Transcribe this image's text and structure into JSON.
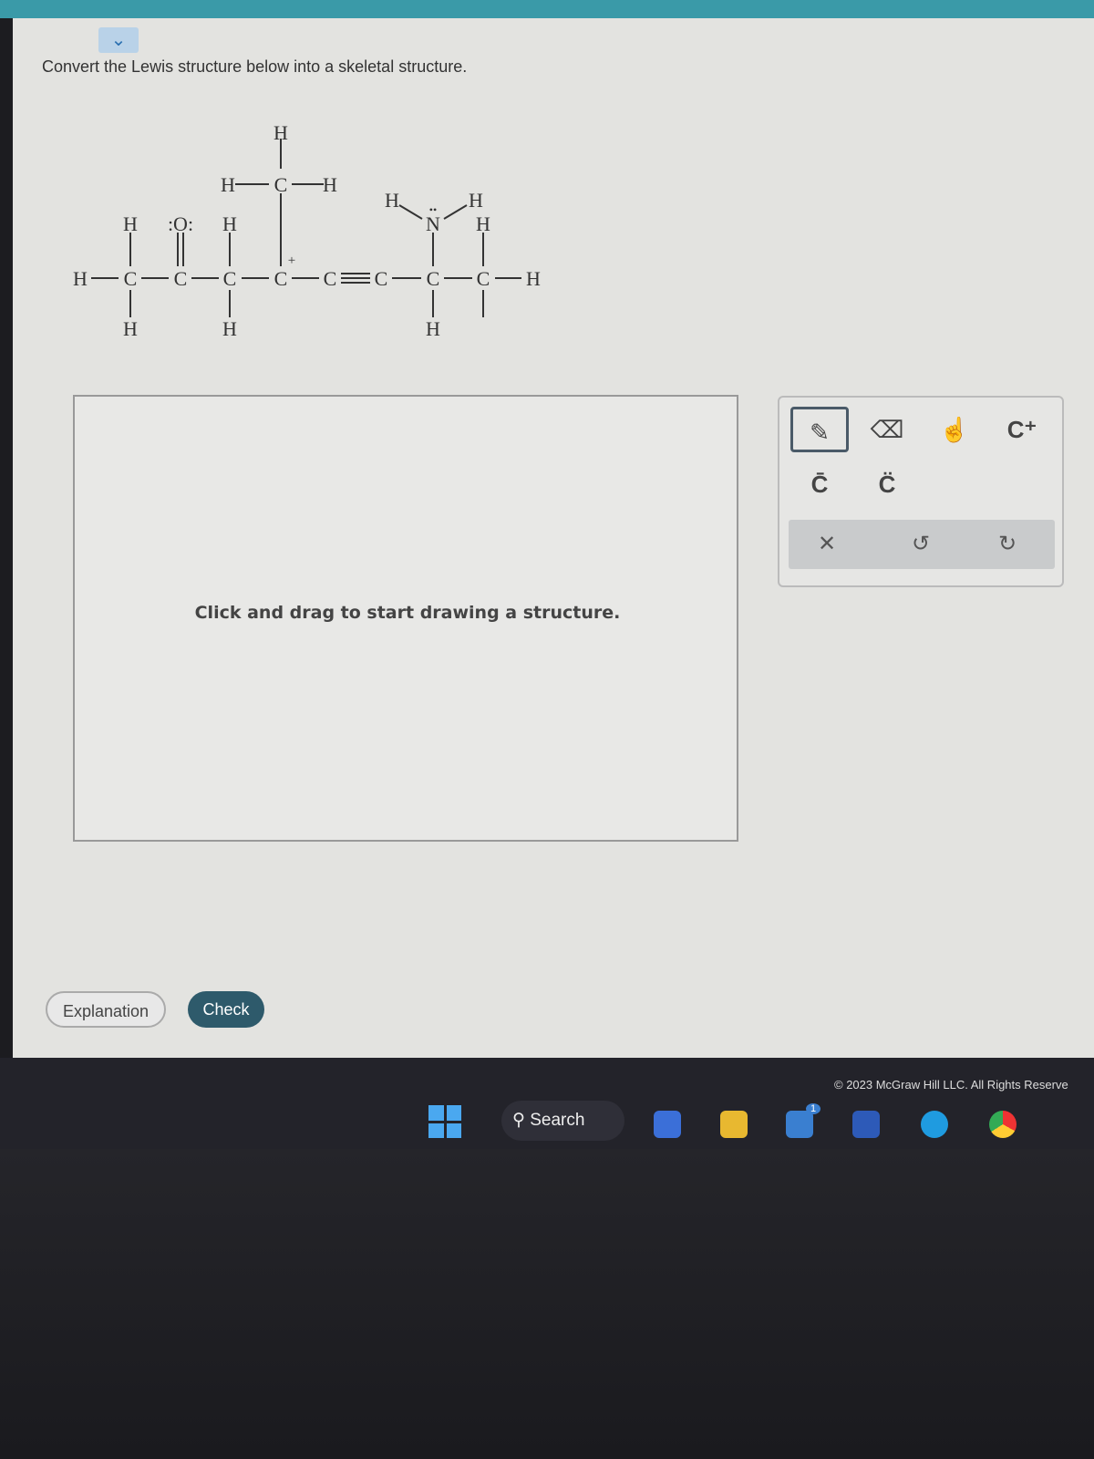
{
  "question": {
    "prompt": "Convert the Lewis structure below into a skeletal structure.",
    "collapse_icon": "chevron-down-icon"
  },
  "lewis": {
    "atoms": [
      "H",
      "C",
      "C",
      "C",
      "C",
      "C",
      "C",
      "C",
      "C",
      "H",
      "H",
      "H",
      ":O:",
      "H",
      "H",
      "H",
      "C",
      "H",
      "H",
      "N",
      "H",
      "H",
      "H",
      "H"
    ],
    "charge": "+",
    "lone_pair": "••"
  },
  "canvas": {
    "hint": "Click and drag to start drawing a structure."
  },
  "toolbar": {
    "tools": [
      {
        "icon": "pencil-icon",
        "selected": true
      },
      {
        "icon": "eraser-icon"
      },
      {
        "icon": "hand-icon"
      },
      {
        "label": "C⁺",
        "icon": "carbocation-icon"
      },
      {
        "label": "C̄",
        "icon": "carbanion-icon"
      },
      {
        "label": "C̈",
        "icon": "lone-pair-icon"
      }
    ],
    "actions": [
      {
        "label": "✕",
        "icon": "clear-icon"
      },
      {
        "label": "↺",
        "icon": "undo-icon"
      },
      {
        "label": "↻",
        "icon": "redo-icon"
      }
    ]
  },
  "buttons": {
    "explanation": "Explanation",
    "check": "Check"
  },
  "footer": {
    "copyright": "© 2023 McGraw Hill LLC. All Rights Reserve"
  },
  "taskbar": {
    "search": "Search",
    "mail_badge": "1"
  }
}
